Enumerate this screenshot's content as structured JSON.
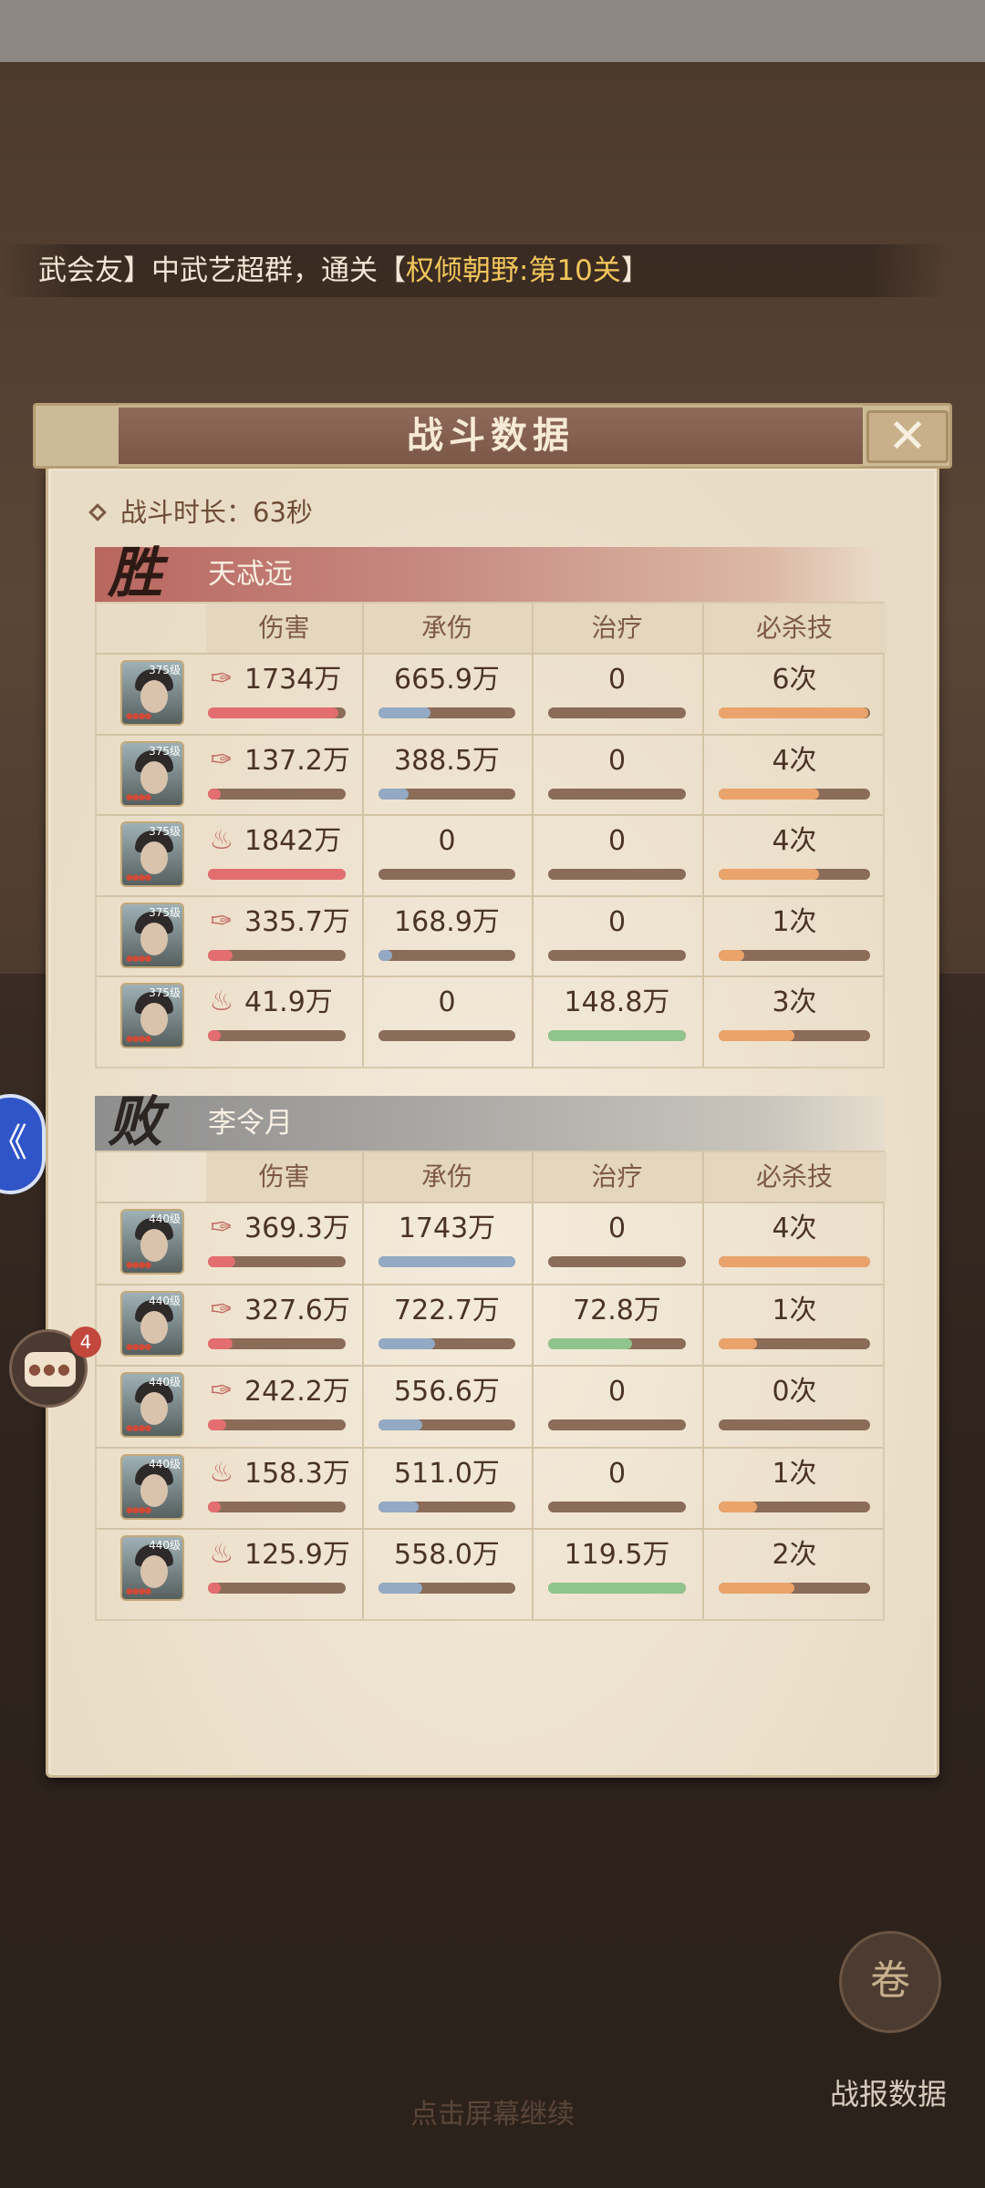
{
  "marquee": {
    "part1": "武会友】中武艺超群，通关【",
    "part2": "权倾朝野:第10关",
    "part3": "】"
  },
  "panel": {
    "title": "战斗数据",
    "close_icon": "close-icon",
    "duration_label": "战斗时长：63秒"
  },
  "columns": [
    "伤害",
    "承伤",
    "治疗",
    "必杀技"
  ],
  "teams": [
    {
      "result": "胜",
      "name": "天忒远",
      "rows": [
        {
          "level": "375级",
          "element": "wind",
          "damage": "1734万",
          "taken": "665.9万",
          "heal": "0",
          "skill": "6次",
          "dmg_pct": 0.95,
          "tak_pct": 0.38,
          "heal_pct": 0,
          "skill_pct": 0.99
        },
        {
          "level": "375级",
          "element": "wind",
          "damage": "137.2万",
          "taken": "388.5万",
          "heal": "0",
          "skill": "4次",
          "dmg_pct": 0.08,
          "tak_pct": 0.22,
          "heal_pct": 0,
          "skill_pct": 0.66
        },
        {
          "level": "375级",
          "element": "fire",
          "damage": "1842万",
          "taken": "0",
          "heal": "0",
          "skill": "4次",
          "dmg_pct": 1.0,
          "tak_pct": 0,
          "heal_pct": 0,
          "skill_pct": 0.66
        },
        {
          "level": "375级",
          "element": "wind",
          "damage": "335.7万",
          "taken": "168.9万",
          "heal": "0",
          "skill": "1次",
          "dmg_pct": 0.18,
          "tak_pct": 0.1,
          "heal_pct": 0,
          "skill_pct": 0.17
        },
        {
          "level": "375级",
          "element": "fire",
          "damage": "41.9万",
          "taken": "0",
          "heal": "148.8万",
          "skill": "3次",
          "dmg_pct": 0.03,
          "tak_pct": 0,
          "heal_pct": 1.0,
          "skill_pct": 0.5
        }
      ]
    },
    {
      "result": "败",
      "name": "李令月",
      "rows": [
        {
          "level": "440级",
          "element": "wind",
          "damage": "369.3万",
          "taken": "1743万",
          "heal": "0",
          "skill": "4次",
          "dmg_pct": 0.2,
          "tak_pct": 1.0,
          "heal_pct": 0,
          "skill_pct": 1.0
        },
        {
          "level": "440级",
          "element": "wind",
          "damage": "327.6万",
          "taken": "722.7万",
          "heal": "72.8万",
          "skill": "1次",
          "dmg_pct": 0.18,
          "tak_pct": 0.41,
          "heal_pct": 0.61,
          "skill_pct": 0.25
        },
        {
          "level": "440级",
          "element": "wind",
          "damage": "242.2万",
          "taken": "556.6万",
          "heal": "0",
          "skill": "0次",
          "dmg_pct": 0.13,
          "tak_pct": 0.32,
          "heal_pct": 0,
          "skill_pct": 0
        },
        {
          "level": "440级",
          "element": "fire",
          "damage": "158.3万",
          "taken": "511.0万",
          "heal": "0",
          "skill": "1次",
          "dmg_pct": 0.09,
          "tak_pct": 0.29,
          "heal_pct": 0,
          "skill_pct": 0.25
        },
        {
          "level": "440级",
          "element": "fire",
          "damage": "125.9万",
          "taken": "558.0万",
          "heal": "119.5万",
          "skill": "2次",
          "dmg_pct": 0.07,
          "tak_pct": 0.32,
          "heal_pct": 1.0,
          "skill_pct": 0.5
        }
      ]
    }
  ],
  "side": {
    "chat_count": "4",
    "blue_icon": "speed-icon",
    "chat_icon": "chat-icon"
  },
  "footer": {
    "continue_hint": "点击屏幕继续",
    "report_label": "战报数据",
    "report_icon": "scroll-icon"
  },
  "colors": {
    "damage": "#e36e70",
    "taken": "#93a9c4",
    "heal": "#8fc48c",
    "skill": "#eaa36a"
  }
}
